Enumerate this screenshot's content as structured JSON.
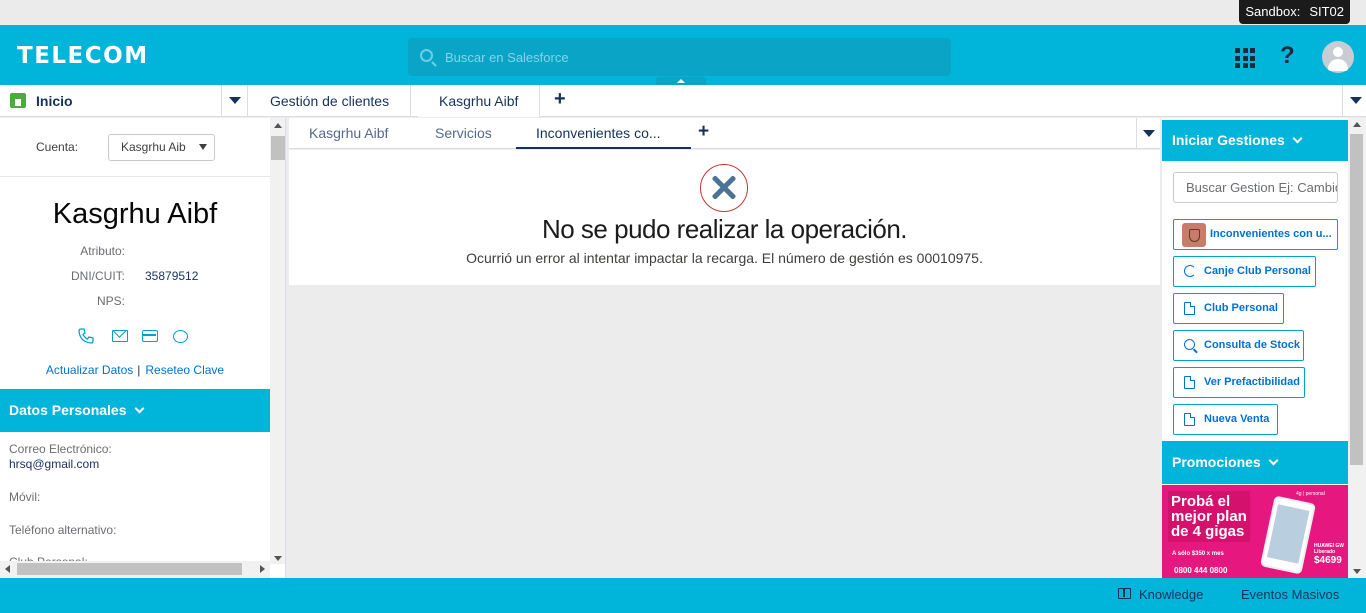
{
  "sandbox": {
    "label": "Sandbox:",
    "name": "SIT02"
  },
  "header": {
    "logo": "TELECOM",
    "search_placeholder": "Buscar en Salesforce",
    "icons": [
      "apps-grid-icon",
      "help-icon",
      "avatar-icon"
    ],
    "help_glyph": "?"
  },
  "nav": {
    "home_label": "Inicio",
    "tabs": [
      {
        "label": "Gestión de clientes"
      },
      {
        "label": "Kasgrhu Aibf",
        "active": true
      }
    ]
  },
  "account": {
    "cuenta_label": "Cuenta:",
    "cuenta_value": "Kasgrhu Aib",
    "name": "Kasgrhu Aibf",
    "fields": [
      {
        "label": "Atributo:",
        "value": ""
      },
      {
        "label": "DNI/CUIT:",
        "value": "35879512"
      },
      {
        "label": "NPS:",
        "value": ""
      }
    ],
    "links": {
      "update": "Actualizar Datos",
      "separator": "|",
      "reset": "Reseteo Clave"
    }
  },
  "datos_personales": {
    "title": "Datos Personales",
    "fields": [
      {
        "label": "Correo Electrónico:",
        "value": "hrsq@gmail.com"
      },
      {
        "label": "Móvil:",
        "value": ""
      },
      {
        "label": "Teléfono alternativo:",
        "value": ""
      },
      {
        "label": "Club Personal:",
        "value": ""
      }
    ]
  },
  "subtabs": [
    {
      "label": "Kasgrhu Aibf"
    },
    {
      "label": "Servicios"
    },
    {
      "label": "Inconvenientes co...",
      "active": true
    }
  ],
  "error": {
    "title": "No se pudo realizar la operación.",
    "message": "Ocurrió un error al intentar impactar la recarga. El número de gestión es 00010975."
  },
  "gestiones": {
    "title": "Iniciar Gestiones",
    "search_placeholder": "Buscar Gestion Ej: Cambio",
    "buttons": [
      {
        "label": "Inconvenientes con u...",
        "icon": "shield-icon"
      },
      {
        "label": "Canje Club Personal",
        "icon": "refresh-icon"
      },
      {
        "label": "Club Personal",
        "icon": "document-icon"
      },
      {
        "label": "Consulta de Stock",
        "icon": "search-icon"
      },
      {
        "label": "Ver Prefactibilidad",
        "icon": "document-icon"
      },
      {
        "label": "Nueva Venta",
        "icon": "document-icon"
      }
    ]
  },
  "promociones": {
    "title": "Promociones",
    "banner": {
      "headline": "Probá el mejor plan de 4 gigas",
      "sub": "A sólo $350 x mes",
      "phone": "0800 444 0800",
      "brand": "4g | personal",
      "model": "HUAWEI GW",
      "price_label": "Liberado",
      "price": "$4699"
    }
  },
  "footer": {
    "knowledge": "Knowledge",
    "eventos": "Eventos Masivos"
  },
  "colors": {
    "brand": "#00b5d9",
    "link": "#0070d2",
    "error": "#c23934",
    "promo": "#e6177e"
  }
}
